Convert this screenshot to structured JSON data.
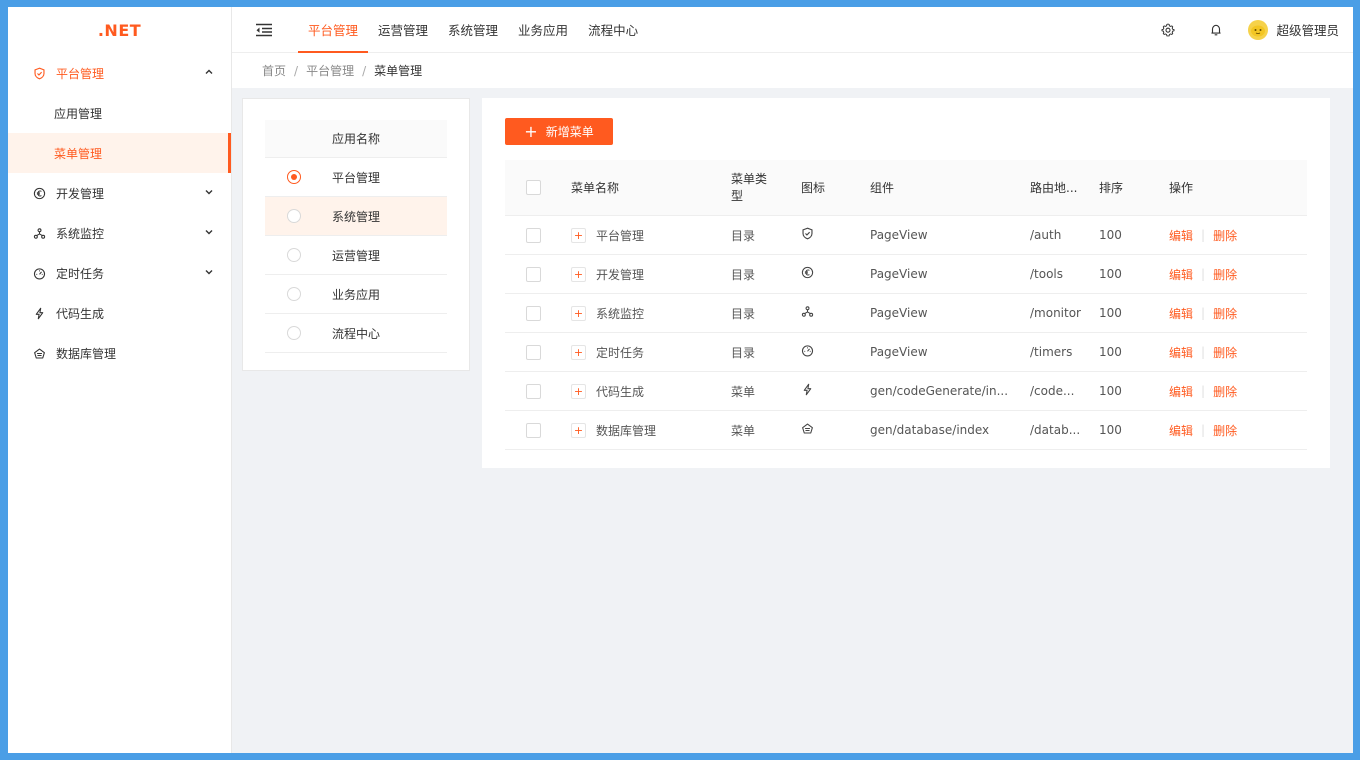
{
  "logo": ".NET",
  "sidebar": {
    "items": [
      {
        "label": "平台管理",
        "icon": "shield-icon",
        "expanded": true
      },
      {
        "label": "应用管理",
        "sub": true
      },
      {
        "label": "菜单管理",
        "sub": true,
        "selected": true
      },
      {
        "label": "开发管理",
        "icon": "euro-icon"
      },
      {
        "label": "系统监控",
        "icon": "cluster-icon"
      },
      {
        "label": "定时任务",
        "icon": "dashboard-icon"
      },
      {
        "label": "代码生成",
        "icon": "thunder-icon"
      },
      {
        "label": "数据库管理",
        "icon": "database-icon"
      }
    ]
  },
  "header": {
    "tabs": [
      "平台管理",
      "运营管理",
      "系统管理",
      "业务应用",
      "流程中心"
    ],
    "active_tab": 0,
    "user_name": "超级管理员"
  },
  "breadcrumb": [
    "首页",
    "平台管理",
    "菜单管理"
  ],
  "app_panel": {
    "header": "应用名称",
    "rows": [
      {
        "label": "平台管理",
        "checked": true
      },
      {
        "label": "系统管理"
      },
      {
        "label": "运营管理"
      },
      {
        "label": "业务应用"
      },
      {
        "label": "流程中心"
      }
    ]
  },
  "menu_panel": {
    "add_label": "新增菜单",
    "columns": {
      "name": "菜单名称",
      "type": "菜单类型",
      "icon": "图标",
      "component": "组件",
      "route": "路由地...",
      "sort": "排序",
      "ops": "操作"
    },
    "edit_label": "编辑",
    "delete_label": "删除",
    "rows": [
      {
        "name": "平台管理",
        "type": "目录",
        "icon": "shield-icon",
        "component": "PageView",
        "route": "/auth",
        "sort": "100"
      },
      {
        "name": "开发管理",
        "type": "目录",
        "icon": "euro-icon",
        "component": "PageView",
        "route": "/tools",
        "sort": "100"
      },
      {
        "name": "系统监控",
        "type": "目录",
        "icon": "cluster-icon",
        "component": "PageView",
        "route": "/monitor",
        "sort": "100"
      },
      {
        "name": "定时任务",
        "type": "目录",
        "icon": "dashboard-icon",
        "component": "PageView",
        "route": "/timers",
        "sort": "100"
      },
      {
        "name": "代码生成",
        "type": "菜单",
        "icon": "thunder-icon",
        "component": "gen/codeGenerate/in...",
        "route": "/code...",
        "sort": "100"
      },
      {
        "name": "数据库管理",
        "type": "菜单",
        "icon": "database-icon",
        "component": "gen/database/index",
        "route": "/datab...",
        "sort": "100"
      }
    ]
  },
  "colors": {
    "accent": "#ff5a1f",
    "accent_light": "#fff3eb",
    "frame": "#4a9ee6"
  }
}
